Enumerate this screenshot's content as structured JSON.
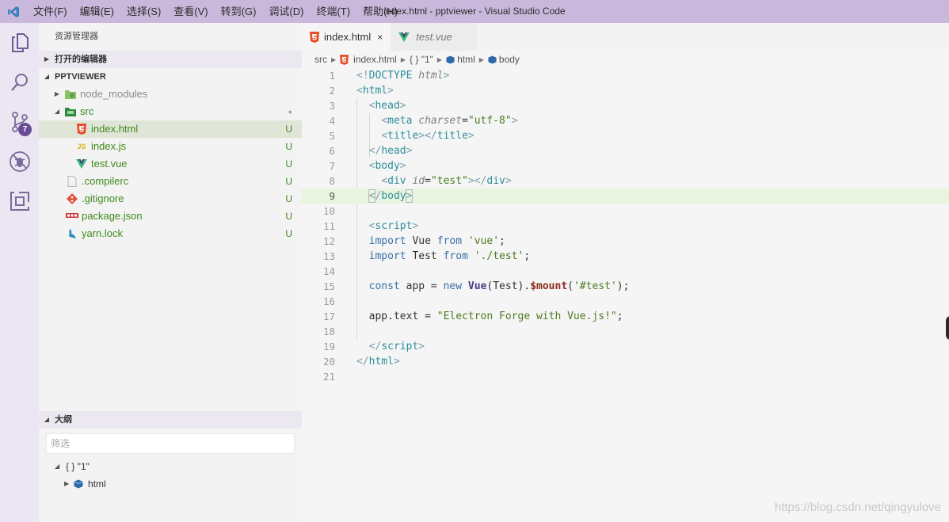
{
  "window": {
    "title": "index.html - pptviewer - Visual Studio Code",
    "menu": [
      "文件(F)",
      "编辑(E)",
      "选择(S)",
      "查看(V)",
      "转到(G)",
      "调试(D)",
      "终端(T)",
      "帮助(H)"
    ]
  },
  "activity": {
    "badge": "7"
  },
  "sidebar": {
    "title": "资源管理器",
    "open_editors": "打开的编辑器",
    "project": "PPTVIEWER",
    "tree": [
      {
        "label": "node_modules",
        "status": ""
      },
      {
        "label": "src",
        "status": "●"
      },
      {
        "label": "index.html",
        "status": "U"
      },
      {
        "label": "index.js",
        "status": "U"
      },
      {
        "label": "test.vue",
        "status": "U"
      },
      {
        "label": ".compilerc",
        "status": "U"
      },
      {
        "label": ".gitignore",
        "status": "U"
      },
      {
        "label": "package.json",
        "status": "U"
      },
      {
        "label": "yarn.lock",
        "status": "U"
      }
    ],
    "outline": {
      "title": "大纲",
      "filter_placeholder": "筛选",
      "root": "{ } \"1\"",
      "child": "html"
    }
  },
  "editor": {
    "tabs": [
      {
        "label": "index.html",
        "close": "×"
      },
      {
        "label": "test.vue"
      }
    ],
    "breadcrumb": [
      "src",
      "index.html",
      "{ } \"1\"",
      "html",
      "body"
    ],
    "line_numbers": [
      "1",
      "2",
      "3",
      "4",
      "5",
      "6",
      "7",
      "8",
      "9",
      "10",
      "11",
      "12",
      "13",
      "14",
      "15",
      "16",
      "17",
      "18",
      "19",
      "20",
      "21"
    ]
  },
  "watermark": "https://blog.csdn.net/qingyulove",
  "colors": {
    "titlebar": "#c9b8dc",
    "activitybar": "#ebe6f1",
    "selection": "#dfe5d7",
    "current_line": "#e8f4e0"
  }
}
